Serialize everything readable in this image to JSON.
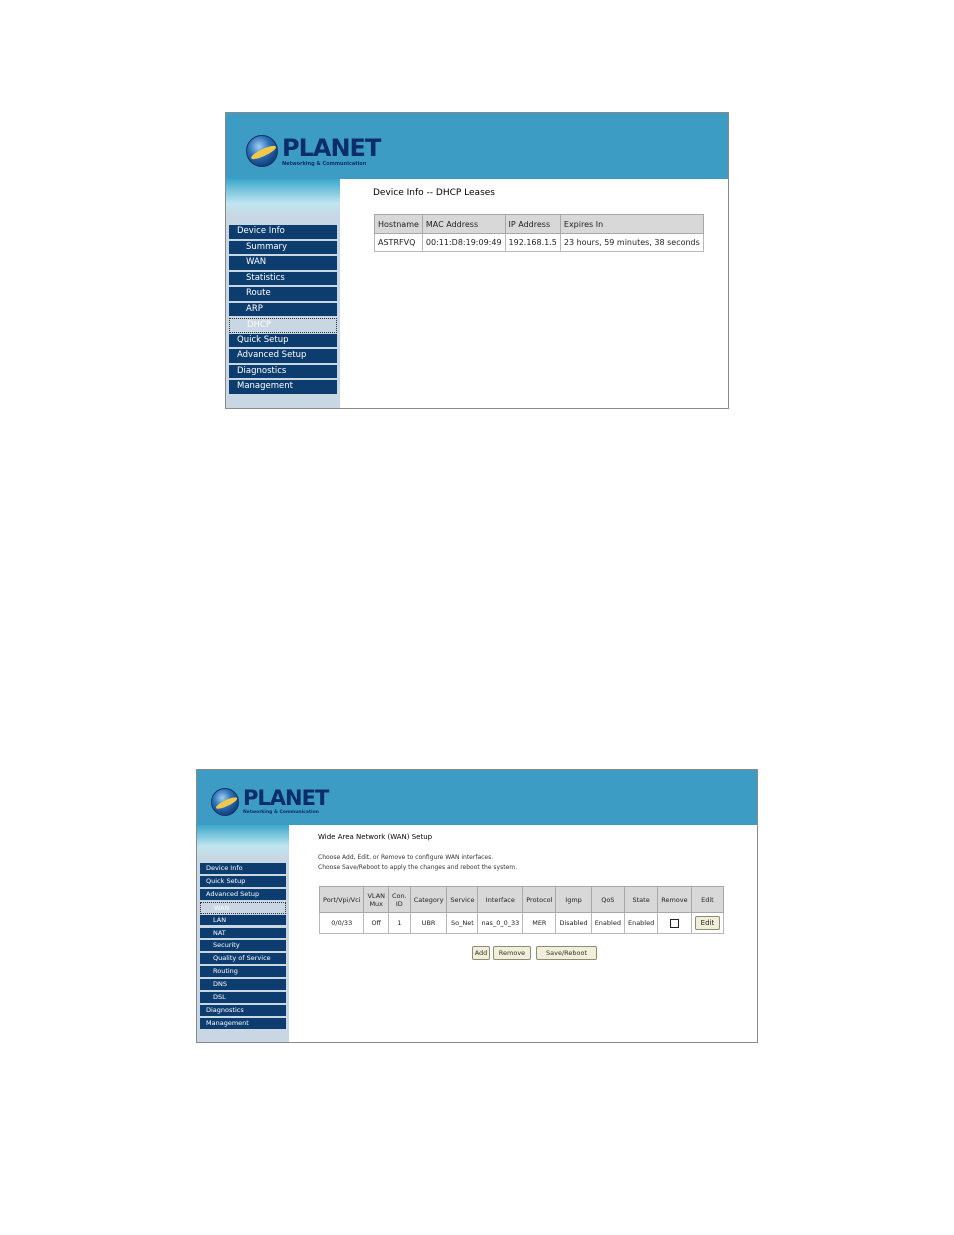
{
  "colors": {
    "banner": "#3d9cc3",
    "menu": "#0d3d6e",
    "sidebar": "#c9d6e3",
    "table_header": "#d8d8d8"
  },
  "logo": {
    "brand": "PLANET",
    "tagline": "Networking & Communication",
    "icon": "globe-icon"
  },
  "screen1": {
    "title": "Device Info -- DHCP Leases",
    "menu": [
      {
        "label": "Device Info",
        "sub": false,
        "selected": false
      },
      {
        "label": "Summary",
        "sub": true,
        "selected": false
      },
      {
        "label": "WAN",
        "sub": true,
        "selected": false
      },
      {
        "label": "Statistics",
        "sub": true,
        "selected": false
      },
      {
        "label": "Route",
        "sub": true,
        "selected": false
      },
      {
        "label": "ARP",
        "sub": true,
        "selected": false
      },
      {
        "label": "DHCP",
        "sub": true,
        "selected": true
      },
      {
        "label": "Quick Setup",
        "sub": false,
        "selected": false
      },
      {
        "label": "Advanced Setup",
        "sub": false,
        "selected": false
      },
      {
        "label": "Diagnostics",
        "sub": false,
        "selected": false
      },
      {
        "label": "Management",
        "sub": false,
        "selected": false
      }
    ],
    "table": {
      "headers": [
        "Hostname",
        "MAC Address",
        "IP Address",
        "Expires In"
      ],
      "rows": [
        [
          "ASTRFVQ",
          "00:11:D8:19:09:49",
          "192.168.1.5",
          "23 hours, 59 minutes, 38 seconds"
        ]
      ]
    }
  },
  "screen2": {
    "title": "Wide Area Network (WAN) Setup",
    "desc1": "Choose Add, Edit, or Remove to configure WAN interfaces.",
    "desc2": "Choose Save/Reboot to apply the changes and reboot the system.",
    "menu": [
      {
        "label": "Device Info",
        "sub": false,
        "selected": false
      },
      {
        "label": "Quick Setup",
        "sub": false,
        "selected": false
      },
      {
        "label": "Advanced Setup",
        "sub": false,
        "selected": false
      },
      {
        "label": "WAN",
        "sub": true,
        "selected": true
      },
      {
        "label": "LAN",
        "sub": true,
        "selected": false
      },
      {
        "label": "NAT",
        "sub": true,
        "selected": false
      },
      {
        "label": "Security",
        "sub": true,
        "selected": false
      },
      {
        "label": "Quality of Service",
        "sub": true,
        "selected": false
      },
      {
        "label": "Routing",
        "sub": true,
        "selected": false
      },
      {
        "label": "DNS",
        "sub": true,
        "selected": false
      },
      {
        "label": "DSL",
        "sub": true,
        "selected": false
      },
      {
        "label": "Diagnostics",
        "sub": false,
        "selected": false
      },
      {
        "label": "Management",
        "sub": false,
        "selected": false
      }
    ],
    "table": {
      "headers": [
        [
          "Port/Vpi/Vci"
        ],
        [
          "VLAN",
          "Mux"
        ],
        [
          "Con.",
          "ID"
        ],
        [
          "Category"
        ],
        [
          "Service"
        ],
        [
          "Interface"
        ],
        [
          "Protocol"
        ],
        [
          "Igmp"
        ],
        [
          "QoS"
        ],
        [
          "State"
        ],
        [
          "Remove"
        ],
        [
          "Edit"
        ]
      ],
      "rows": [
        {
          "port": "0/0/33",
          "vlan_mux": "Off",
          "con_id": "1",
          "category": "UBR",
          "service": "So_Net",
          "interface": "nas_0_0_33",
          "protocol": "MER",
          "igmp": "Disabled",
          "qos": "Enabled",
          "state": "Enabled",
          "remove_checked": false,
          "edit_label": "Edit"
        }
      ]
    },
    "buttons": {
      "add": "Add",
      "remove": "Remove",
      "save_reboot": "Save/Reboot"
    }
  }
}
